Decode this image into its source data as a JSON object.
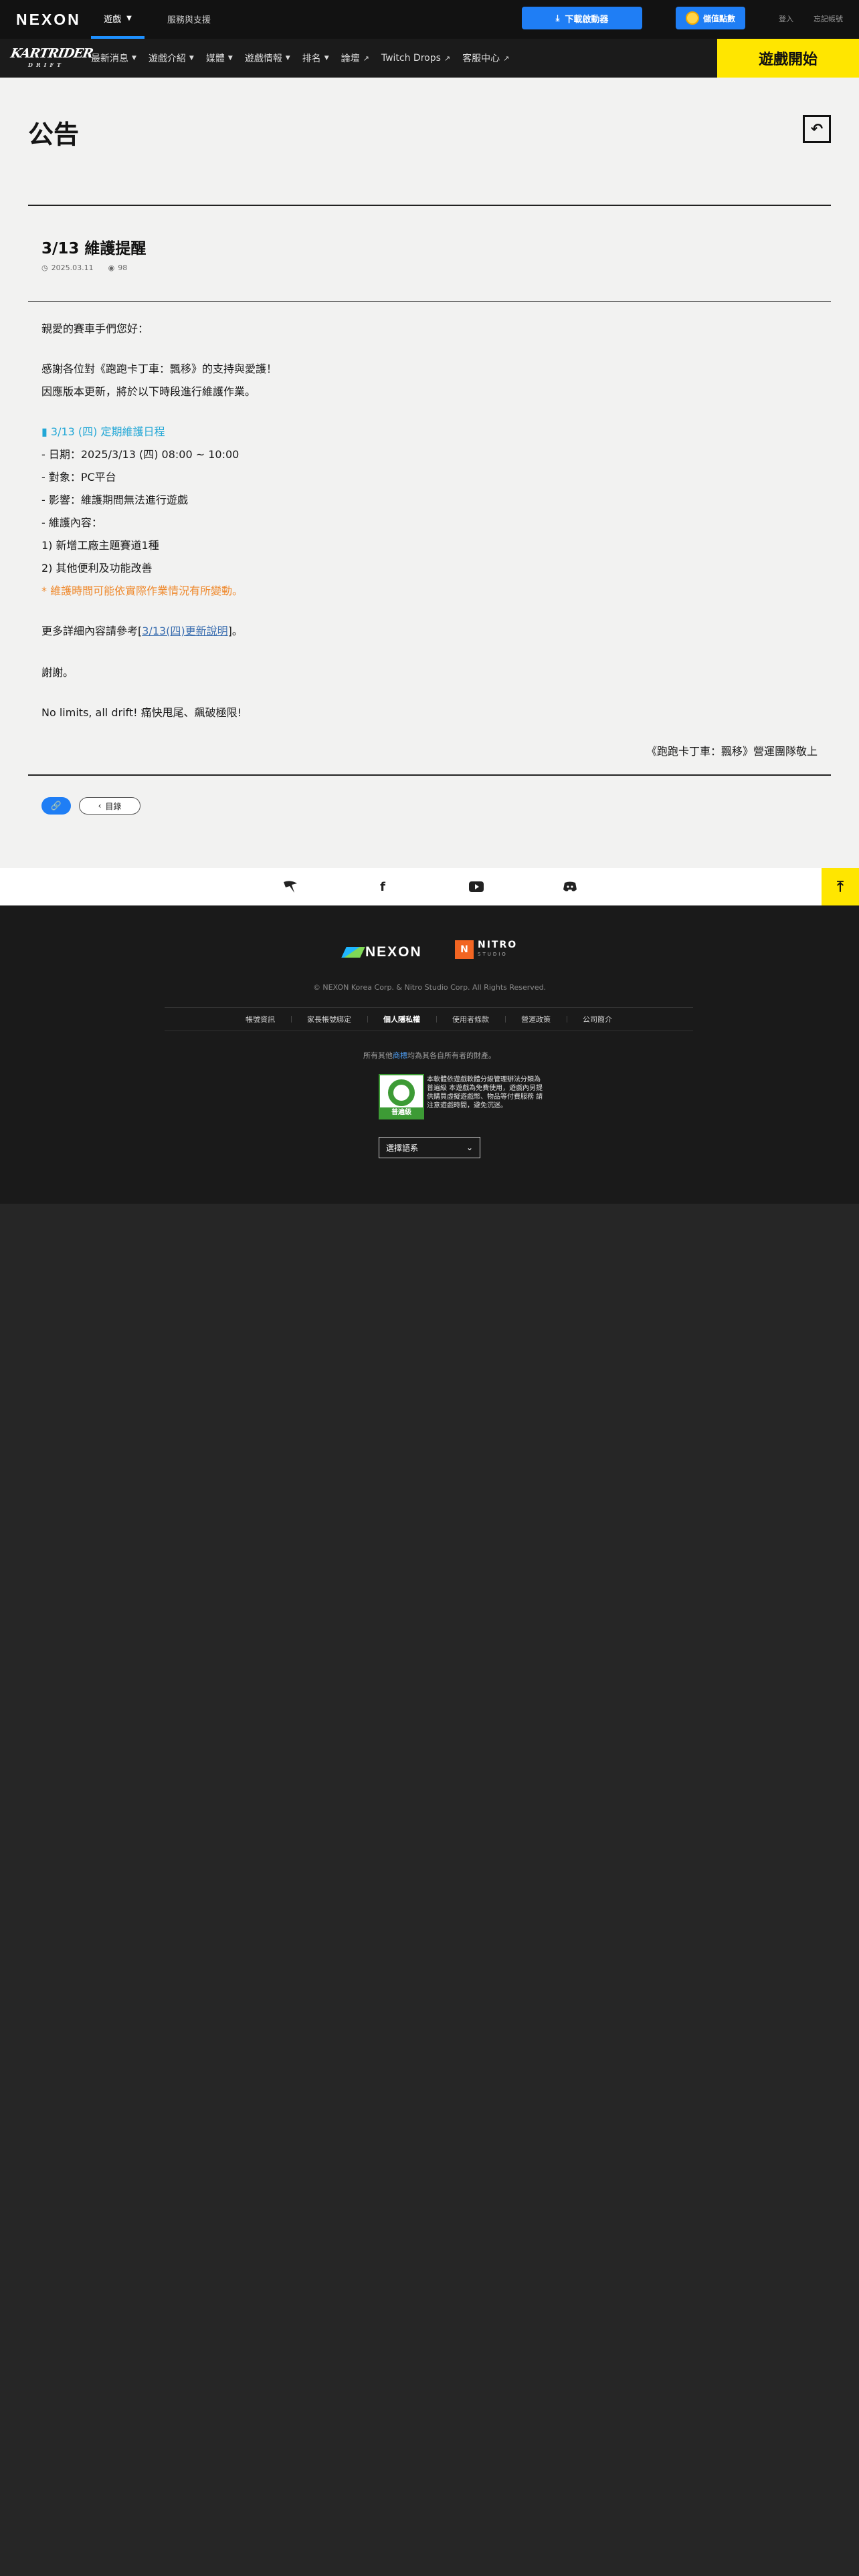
{
  "topbar": {
    "brand": "NEXON",
    "games_menu": "遊戲",
    "support": "服務與支援",
    "download": "下載啟動器",
    "points": "儲值點數",
    "login": "登入",
    "forgot": "忘記帳號"
  },
  "gamenav": {
    "logo_line1": "KARTRIDER",
    "logo_line2": "DRIFT",
    "items": [
      {
        "label": "最新消息",
        "suffix": "⌄"
      },
      {
        "label": "遊戲介紹",
        "suffix": "⌄"
      },
      {
        "label": "媒體",
        "suffix": "⌄"
      },
      {
        "label": "遊戲情報",
        "suffix": "⌄"
      },
      {
        "label": "排名",
        "suffix": "⌄"
      },
      {
        "label": "論壇",
        "suffix": "↗"
      },
      {
        "label": "Twitch Drops",
        "suffix": "↗"
      },
      {
        "label": "客服中心",
        "suffix": "↗"
      }
    ],
    "play_button": "遊戲開始"
  },
  "notice": {
    "page_title": "公告",
    "post_title": "3/13 維護提醒",
    "date": "2025.03.11",
    "views": "98",
    "lines": {
      "greet": "親愛的賽車手們您好：",
      "thanks": "感謝各位對《跑跑卡丁車：飄移》的支持與愛護！",
      "reason": "因應版本更新，將於以下時段進行維護作業。",
      "schedule_head": "▮ 3/13 (四) 定期維護日程",
      "date_line": "- 日期：2025/3/13 (四) 08:00 ~ 10:00",
      "target": "- 對象：PC平台",
      "impact": "- 影響：維護期間無法進行遊戲",
      "content_head": "- 維護內容：",
      "item1": "1) 新增工廠主題賽道1種",
      "item2": "2) 其他便利及功能改善",
      "note": "* 維護時間可能依實際作業情況有所變動。",
      "more_prefix": "更多詳細內容請參考[",
      "more_link": "3/13(四)更新說明",
      "more_suffix": "]。",
      "thankyou": "謝謝。",
      "slogan": "No limits, all drift! 痛快甩尾、飆破極限!",
      "signature": "《跑跑卡丁車：飄移》營運團隊敬上"
    },
    "list_button": "目錄"
  },
  "footer": {
    "nexon": "NEXON",
    "nitro_box": "N",
    "nitro": "NITRO",
    "nitro_sub": "STUDIO",
    "copyright": "© NEXON Korea Corp. & Nitro Studio Corp. All Rights Reserved.",
    "links": [
      "帳號資訊",
      "家長帳號綁定",
      "個人隱私權",
      "使用者條款",
      "營運政策",
      "公司簡介"
    ],
    "trade_prefix": "所有其他",
    "trade_hl": "商標",
    "trade_suffix": "均為其各自所有者的財產。",
    "rating_label": "普遍級",
    "rating_text": "本軟體依遊戲軟體分級管理辦法分類為 普遍級 本遊戲為免費使用，遊戲內另提供購買虛擬遊戲幣、物品等付費服務 請注意遊戲時間，避免沉迷。",
    "language": "選擇語系"
  }
}
